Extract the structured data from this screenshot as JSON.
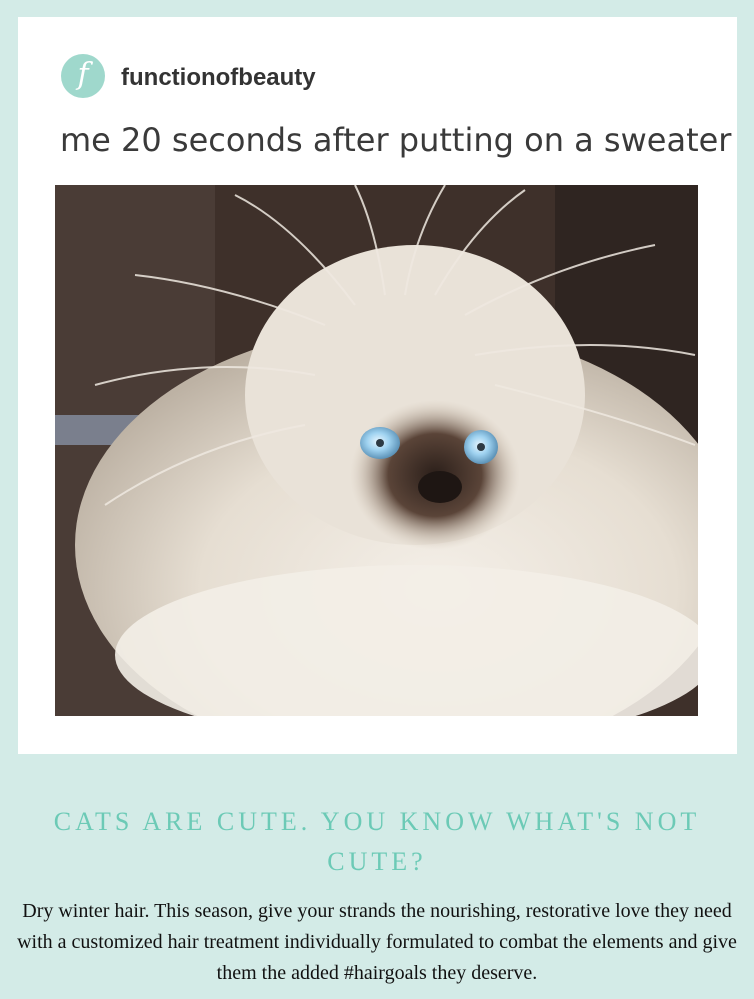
{
  "post": {
    "avatar_letter": "f",
    "avatar_color": "#9fd8cc",
    "username": "functionofbeauty",
    "caption": "me 20 seconds after putting on a sweater",
    "image_subject": "fluffy-cat-with-static-hair"
  },
  "promo": {
    "headline": "CATS ARE CUTE. YOU KNOW WHAT'S NOT CUTE?",
    "body": "Dry winter hair. This season, give your strands the nourishing, restorative love they need with a customized hair treatment individually formulated to combat the elements and give them the added #hairgoals they deserve.",
    "headline_color": "#6ccab6"
  },
  "colors": {
    "background": "#d3ebe7",
    "card": "#ffffff"
  }
}
